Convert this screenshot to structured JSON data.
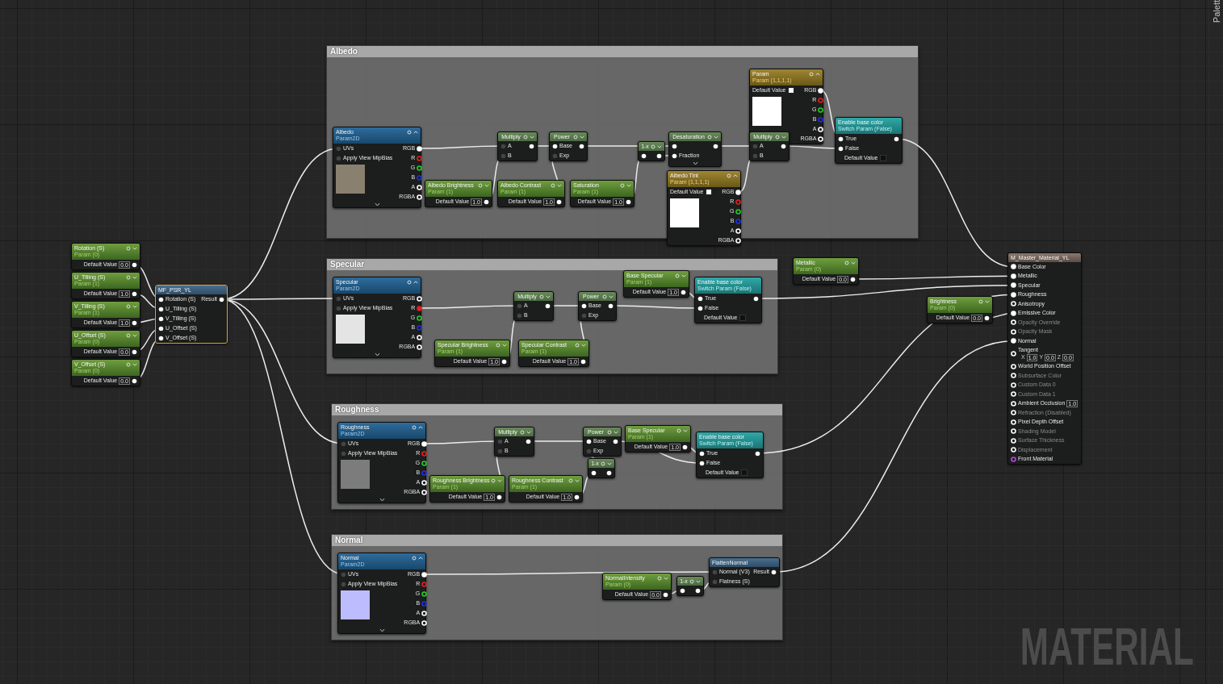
{
  "palette_tab": {
    "label": "Palett"
  },
  "graph_label": "MATERIAL",
  "comments": [
    {
      "title": "Albedo"
    },
    {
      "title": "Specular"
    },
    {
      "title": "Roughness"
    },
    {
      "title": "Normal"
    }
  ],
  "nodes": [
    {
      "kind": "param",
      "title": "Rotation (S)",
      "subtitle": "Param (0)",
      "value_label": "Default Value",
      "value": "0.0"
    },
    {
      "kind": "param",
      "title": "U_Tilling (S)",
      "subtitle": "Param (1)",
      "value_label": "Default Value",
      "value": "1.0"
    },
    {
      "kind": "param",
      "title": "V_Tilling (S)",
      "subtitle": "Param (1)",
      "value_label": "Default Value",
      "value": "1.0"
    },
    {
      "kind": "param",
      "title": "U_Offset (S)",
      "subtitle": "Param (0)",
      "value_label": "Default Value",
      "value": "0.0"
    },
    {
      "kind": "param",
      "title": "V_Offset (S)",
      "subtitle": "Param (0)",
      "value_label": "Default Value",
      "value": "0.0"
    },
    {
      "kind": "function",
      "title": "MF_PSR_YL",
      "selected": true,
      "inputs": [
        {
          "label": "Rotation (S)",
          "connected": true
        },
        {
          "label": "U_Tilling (S)",
          "connected": true
        },
        {
          "label": "V_Tilling (S)",
          "connected": true
        },
        {
          "label": "U_Offset (S)",
          "connected": true
        },
        {
          "label": "V_Offset (S)",
          "connected": true
        }
      ],
      "output": "Result"
    },
    {
      "kind": "texture",
      "title": "Albedo",
      "subtitle": "Param2D",
      "color": "#8a8070",
      "inputs": [
        {
          "label": "UVs"
        },
        {
          "label": "Apply View MipBias"
        }
      ],
      "outputs": [
        {
          "label": "RGB",
          "color": "#ffffff",
          "connected": true
        },
        {
          "label": "R",
          "color": "#e02020",
          "connected": false
        },
        {
          "label": "G",
          "color": "#20d020",
          "connected": false
        },
        {
          "label": "B",
          "color": "#2030e0",
          "connected": false
        },
        {
          "label": "A",
          "color": "#ffffff",
          "connected": false
        },
        {
          "label": "RGBA",
          "color": "#ffffff",
          "connected": false
        }
      ]
    },
    {
      "kind": "param",
      "title": "Albedo Brightness",
      "subtitle": "Param (1)",
      "value_label": "Default Value",
      "value": "1.0"
    },
    {
      "kind": "math",
      "title": "Multiply",
      "inputs": [
        {
          "label": "A",
          "connected": false
        },
        {
          "label": "B",
          "connected": false
        }
      ]
    },
    {
      "kind": "param",
      "title": "Albedo Contrast",
      "subtitle": "Param (1)",
      "value_label": "Default Value",
      "value": "1.0"
    },
    {
      "kind": "math",
      "title": "Power",
      "inputs": [
        {
          "label": "Base",
          "connected": true
        },
        {
          "label": "Exp",
          "connected": false
        }
      ]
    },
    {
      "kind": "param",
      "title": "Saturation",
      "subtitle": "Param (1)",
      "value_label": "Default Value",
      "value": "1.0"
    },
    {
      "kind": "math",
      "title": "1-x",
      "inputs": [
        {
          "connected": true
        }
      ]
    },
    {
      "kind": "math",
      "title": "Desaturation",
      "expandable": true,
      "inputs": [
        {
          "connected": true
        },
        {
          "label": "Fraction",
          "connected": true
        }
      ]
    },
    {
      "kind": "vector",
      "title": "Albedo Tint",
      "subtitle": "Param (1,1,1,1)",
      "value_label": "Default Value",
      "color": "#ffffff",
      "outputs": [
        {
          "label": "RGB",
          "color": "#ffffff",
          "connected": true
        },
        {
          "label": "R",
          "color": "#e02020",
          "connected": false
        },
        {
          "label": "G",
          "color": "#20d020",
          "connected": false
        },
        {
          "label": "B",
          "color": "#2030e0",
          "connected": false
        },
        {
          "label": "A",
          "color": "#ffffff",
          "connected": false
        },
        {
          "label": "RGBA",
          "color": "#ffffff",
          "connected": false
        }
      ]
    },
    {
      "kind": "vector",
      "title": "Param",
      "subtitle": "Param (1,1,1,1)",
      "value_label": "Default Value",
      "color": "#ffffff",
      "outputs": [
        {
          "label": "RGB",
          "color": "#ffffff",
          "connected": true
        },
        {
          "label": "R",
          "color": "#e02020",
          "connected": false
        },
        {
          "label": "G",
          "color": "#20d020",
          "connected": false
        },
        {
          "label": "B",
          "color": "#2030e0",
          "connected": false
        },
        {
          "label": "A",
          "color": "#ffffff",
          "connected": false
        },
        {
          "label": "RGBA",
          "color": "#ffffff",
          "connected": false
        }
      ]
    },
    {
      "kind": "math",
      "title": "Multiply",
      "inputs": [
        {
          "label": "A",
          "connected": false
        },
        {
          "label": "B",
          "connected": false
        }
      ]
    },
    {
      "kind": "switch",
      "title": "Enable base color",
      "subtitle": "Switch Param (False)",
      "inputs": [
        {
          "label": "True"
        },
        {
          "label": "False"
        }
      ],
      "value_label": "Default Value",
      "checked": false
    },
    {
      "kind": "texture",
      "title": "Specular",
      "subtitle": "Param2D",
      "color": "#e4e4e4",
      "inputs": [
        {
          "label": "UVs"
        },
        {
          "label": "Apply View MipBias"
        }
      ],
      "outputs": [
        {
          "label": "RGB",
          "color": "#ffffff",
          "connected": false
        },
        {
          "label": "R",
          "color": "#e02020",
          "connected": true
        },
        {
          "label": "G",
          "color": "#20d020",
          "connected": false
        },
        {
          "label": "B",
          "color": "#2030e0",
          "connected": false
        },
        {
          "label": "A",
          "color": "#ffffff",
          "connected": false
        },
        {
          "label": "RGBA",
          "color": "#ffffff",
          "connected": false
        }
      ]
    },
    {
      "kind": "math",
      "title": "Multiply",
      "inputs": [
        {
          "label": "A",
          "connected": false
        },
        {
          "label": "B",
          "connected": false
        }
      ]
    },
    {
      "kind": "math",
      "title": "Power",
      "inputs": [
        {
          "label": "Base",
          "connected": true
        },
        {
          "label": "Exp",
          "connected": false
        }
      ]
    },
    {
      "kind": "param",
      "title": "Base Specular",
      "subtitle": "Param (1)",
      "value_label": "Default Value",
      "value": "1.0"
    },
    {
      "kind": "switch",
      "title": "Enable base color",
      "subtitle": "Switch Param (False)",
      "inputs": [
        {
          "label": "True"
        },
        {
          "label": "False"
        }
      ],
      "value_label": "Default Value",
      "checked": false
    },
    {
      "kind": "param",
      "title": "Specular Brightness",
      "subtitle": "Param (1)",
      "value_label": "Default Value",
      "value": "1.0"
    },
    {
      "kind": "param",
      "title": "Specular Contrast",
      "subtitle": "Param (1)",
      "value_label": "Default Value",
      "value": "1.0"
    },
    {
      "kind": "texture",
      "title": "Roughness",
      "subtitle": "Param2D",
      "color": "#7c7c7c",
      "inputs": [
        {
          "label": "UVs"
        },
        {
          "label": "Apply View MipBias"
        }
      ],
      "outputs": [
        {
          "label": "RGB",
          "color": "#ffffff",
          "connected": true
        },
        {
          "label": "R",
          "color": "#e02020",
          "connected": false
        },
        {
          "label": "G",
          "color": "#20d020",
          "connected": false
        },
        {
          "label": "B",
          "color": "#2030e0",
          "connected": false
        },
        {
          "label": "A",
          "color": "#ffffff",
          "connected": false
        },
        {
          "label": "RGBA",
          "color": "#ffffff",
          "connected": false
        }
      ]
    },
    {
      "kind": "math",
      "title": "Multiply",
      "inputs": [
        {
          "label": "A",
          "connected": false
        },
        {
          "label": "B",
          "connected": false
        }
      ]
    },
    {
      "kind": "math",
      "title": "Power",
      "inputs": [
        {
          "label": "Base",
          "connected": true
        },
        {
          "label": "Exp",
          "connected": false
        }
      ]
    },
    {
      "kind": "param",
      "title": "Base Specular",
      "subtitle": "Param (1)",
      "value_label": "Default Value",
      "value": "1.0"
    },
    {
      "kind": "math",
      "title": "1-x",
      "inputs": [
        {
          "connected": true
        }
      ]
    },
    {
      "kind": "switch",
      "title": "Enable base color",
      "subtitle": "Switch Param (False)",
      "inputs": [
        {
          "label": "True"
        },
        {
          "label": "False"
        }
      ],
      "value_label": "Default Value",
      "checked": false
    },
    {
      "kind": "param",
      "title": "Roughness Brightness",
      "subtitle": "Param (1)",
      "value_label": "Default Value",
      "value": "1.0"
    },
    {
      "kind": "param",
      "title": "Roughness Contrast",
      "subtitle": "Param (1)",
      "value_label": "Default Value",
      "value": "1.0"
    },
    {
      "kind": "texture",
      "title": "Normal",
      "subtitle": "Param2D",
      "color": "#bcbcff",
      "inputs": [
        {
          "label": "UVs"
        },
        {
          "label": "Apply View MipBias"
        }
      ],
      "outputs": [
        {
          "label": "RGB",
          "color": "#ffffff",
          "connected": true
        },
        {
          "label": "R",
          "color": "#e02020",
          "connected": false
        },
        {
          "label": "G",
          "color": "#20d020",
          "connected": false
        },
        {
          "label": "B",
          "color": "#2030e0",
          "connected": false
        },
        {
          "label": "A",
          "color": "#ffffff",
          "connected": false
        },
        {
          "label": "RGBA",
          "color": "#ffffff",
          "connected": false
        }
      ]
    },
    {
      "kind": "param",
      "title": "NormalIntensity",
      "subtitle": "Param (0)",
      "value_label": "Default Value",
      "value": "0.0"
    },
    {
      "kind": "math",
      "title": "1-x",
      "inputs": [
        {
          "connected": true
        }
      ]
    },
    {
      "kind": "function",
      "title": "FlattenNormal",
      "selected": false,
      "inputs": [
        {
          "label": "Normal (V3)",
          "connected": false
        },
        {
          "label": "Flatness (S)",
          "connected": false
        }
      ],
      "output": "Result"
    },
    {
      "kind": "param",
      "title": "Metallic",
      "subtitle": "Param (0)",
      "value_label": "Default Value",
      "value": "0.0"
    },
    {
      "kind": "param",
      "title": "Brightness",
      "subtitle": "Param (0)",
      "value_label": "Default Value",
      "value": "0.0"
    },
    {
      "kind": "result",
      "title": "M_Master_Material_YL",
      "pins": [
        {
          "label": "Base Color",
          "connected": true,
          "enabled": true,
          "color": "#ffffff"
        },
        {
          "label": "Metallic",
          "connected": true,
          "enabled": true,
          "color": "#ffffff"
        },
        {
          "label": "Specular",
          "connected": true,
          "enabled": true,
          "color": "#ffffff"
        },
        {
          "label": "Roughness",
          "connected": true,
          "enabled": true,
          "color": "#ffffff"
        },
        {
          "label": "Anisotropy",
          "connected": false,
          "enabled": true,
          "color": "#ffffff"
        },
        {
          "label": "Emissive Color",
          "connected": true,
          "enabled": true,
          "color": "#ffffff"
        },
        {
          "label": "Opacity Override",
          "connected": false,
          "enabled": false,
          "color": "#ffffff"
        },
        {
          "label": "Opacity Mask",
          "connected": false,
          "enabled": false,
          "color": "#ffffff"
        },
        {
          "label": "Normal",
          "connected": true,
          "enabled": true,
          "color": "#ffffff"
        },
        {
          "label": "Tangent",
          "connected": false,
          "enabled": true,
          "color": "#ffffff",
          "vector": [
            {
              "axis": "X",
              "value": "1.0"
            },
            {
              "axis": "Y",
              "value": "0.0"
            },
            {
              "axis": "Z",
              "value": "0.0"
            }
          ]
        },
        {
          "label": "World Position Offset",
          "connected": false,
          "enabled": true,
          "color": "#ffffff"
        },
        {
          "label": "Subsurface Color",
          "connected": false,
          "enabled": false,
          "color": "#ffffff"
        },
        {
          "label": "Custom Data 0",
          "connected": false,
          "enabled": false,
          "color": "#ffffff"
        },
        {
          "label": "Custom Data 1",
          "connected": false,
          "enabled": false,
          "color": "#ffffff"
        },
        {
          "label": "Ambient Occlusion",
          "connected": false,
          "enabled": true,
          "color": "#ffffff",
          "value": "1.0"
        },
        {
          "label": "Refraction (Disabled)",
          "connected": false,
          "enabled": false,
          "color": "#ffffff"
        },
        {
          "label": "Pixel Depth Offset",
          "connected": false,
          "enabled": true,
          "color": "#ffffff"
        },
        {
          "label": "Shading Model",
          "connected": false,
          "enabled": false,
          "color": "#ffffff"
        },
        {
          "label": "Surface Thickness",
          "connected": false,
          "enabled": false,
          "color": "#ffffff"
        },
        {
          "label": "Displacement",
          "connected": false,
          "enabled": false,
          "color": "#ffffff"
        },
        {
          "label": "Front Material",
          "connected": false,
          "enabled": true,
          "color": "#c040f0"
        }
      ]
    }
  ]
}
